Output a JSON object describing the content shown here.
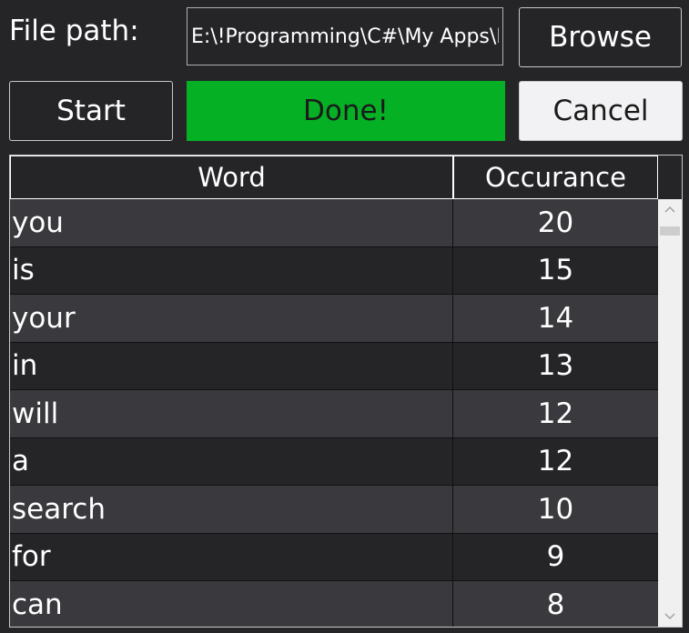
{
  "file_path": {
    "label": "File path:",
    "value": "E:\\!Programming\\C#\\My Apps\\Li"
  },
  "buttons": {
    "browse": "Browse",
    "start": "Start",
    "cancel": "Cancel"
  },
  "status": {
    "text": "Done!",
    "color": "#06b025"
  },
  "table": {
    "columns": [
      "Word",
      "Occurance"
    ],
    "rows": [
      {
        "word": "you",
        "count": "20"
      },
      {
        "word": "is",
        "count": "15"
      },
      {
        "word": "your",
        "count": "14"
      },
      {
        "word": "in",
        "count": "13"
      },
      {
        "word": "will",
        "count": "12"
      },
      {
        "word": "a",
        "count": "12"
      },
      {
        "word": "search",
        "count": "10"
      },
      {
        "word": "for",
        "count": "9"
      },
      {
        "word": "can",
        "count": "8"
      }
    ]
  },
  "scrollbar": {
    "up_icon": "chevron-up-icon",
    "down_icon": "chevron-down-icon"
  }
}
